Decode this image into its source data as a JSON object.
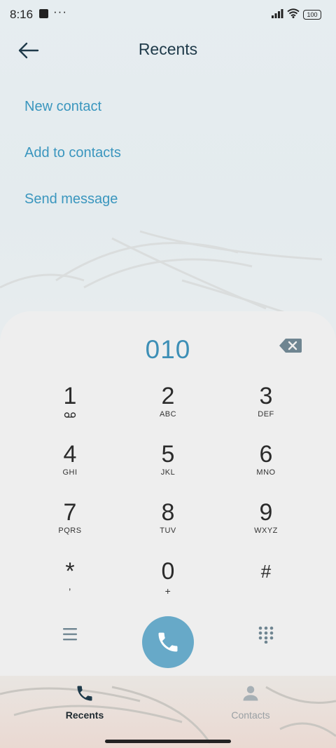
{
  "status_bar": {
    "time": "8:16",
    "dots": "···",
    "battery": "100"
  },
  "header": {
    "title": "Recents"
  },
  "menu": {
    "new_contact": "New contact",
    "add_to_contacts": "Add to contacts",
    "send_message": "Send message"
  },
  "dialpad": {
    "number": "010",
    "keys": [
      {
        "digit": "1",
        "letters": ""
      },
      {
        "digit": "2",
        "letters": "ABC"
      },
      {
        "digit": "3",
        "letters": "DEF"
      },
      {
        "digit": "4",
        "letters": "GHI"
      },
      {
        "digit": "5",
        "letters": "JKL"
      },
      {
        "digit": "6",
        "letters": "MNO"
      },
      {
        "digit": "7",
        "letters": "PQRS"
      },
      {
        "digit": "8",
        "letters": "TUV"
      },
      {
        "digit": "9",
        "letters": "WXYZ"
      },
      {
        "digit": "*",
        "letters": ","
      },
      {
        "digit": "0",
        "letters": "+"
      },
      {
        "digit": "#",
        "letters": ""
      }
    ]
  },
  "bottom_nav": {
    "recents": "Recents",
    "contacts": "Contacts"
  },
  "colors": {
    "accent": "#3a96be",
    "call_button": "#67a9c8"
  }
}
